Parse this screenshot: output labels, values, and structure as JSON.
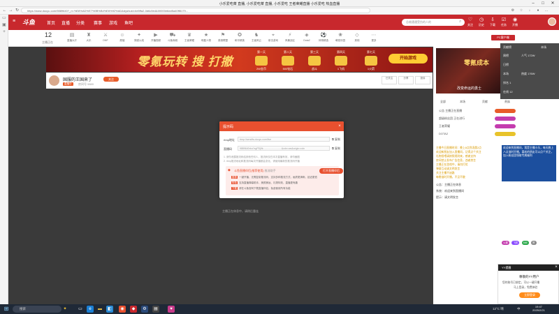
{
  "window": {
    "title": "小乐爱吃菜 直播, 小乐爱吃菜 直播, 小乐爱吃 王者荣耀直播 小乐爱吃 热血直播",
    "url": "https://www.douyu.com/9889640?_ri=%E8%AD%E7%9B%B4%E6%92%AD&dyshuid=be5ffa2-0d6c5b4&00000e6dd5a40ff8179..."
  },
  "site": {
    "logo": "斗鱼",
    "nav": [
      "首页",
      "直播",
      "分类",
      "赛事",
      "游戏",
      "鱼吧"
    ],
    "search_placeholder": "总裁遭遇受伤的人的",
    "header_icons": [
      "关注",
      "历史",
      "下载",
      "任务",
      "开播"
    ]
  },
  "categories": {
    "count": "12",
    "count_label": "主播正在",
    "items": [
      "直播大厅",
      "大乐",
      "DNF",
      "颜值",
      "穿越火线",
      "开播视频",
      "斗鱼商城",
      "王者荣耀",
      "明星人物",
      "英雄联盟",
      "和平精英",
      "王者风云",
      "射击游戏",
      "风暴战区",
      "Dota2",
      "体育精选",
      "萌宠乐园",
      "其他",
      "更多"
    ]
  },
  "banner": {
    "headline": "零氪玩转 搜 打撤",
    "prizes": [
      "第一天",
      "第二天",
      "第三天",
      "第四天",
      "第七天"
    ],
    "prize_values": [
      "2W金币",
      "500钻石",
      "战斗",
      "1飞机",
      "1火箭"
    ],
    "start_label": "开始游戏"
  },
  "streamer": {
    "name": "国服的王国来了",
    "sub": "房间号 9889",
    "tag": "直播中",
    "follow": "关注",
    "buttons": [
      "已关注",
      "分享",
      "投诉"
    ]
  },
  "player": {
    "status": "主播正在休息中，请稍后重连"
  },
  "dialog": {
    "title": "提示码",
    "field1_label": "rtmp地址",
    "field1_value": "rtmp://sendfw.douyu.com/live",
    "field2_label": "直播码",
    "field2_value": "9889640rbu?xgPDj9k...........................&cdn=ws&origin=cdn",
    "copy_label": "复制",
    "note1": "1. 请勿泄露推流码给其他任何人，推流码仅在本次直播有效，请勿截图",
    "note2": "2. rtmp推流地址和推流码每次开播都会变化，请使用最新的推流码开播",
    "promo_title": "斗鱼直播伴侣(推荐使用)",
    "promo_link": "推流助手",
    "promo_button": "打开直播伴侣",
    "promo_lines": [
      {
        "tag": "推荐",
        "text": "一键开播，无需复制推流码，支持多种推流方式，画质更清晰，延迟更低"
      },
      {
        "tag": "特色",
        "text": "支持直播弹幕助手、美颜美妆、礼物特效，直播更有趣"
      },
      {
        "tag": "下载",
        "text": "请在斗鱼官网下载直播伴侣，免费使用所有功能"
      }
    ]
  },
  "right_panel": {
    "pc_client": "PC客户端",
    "ad_text": "改变命运的勇士",
    "ad_title": "零氪成本",
    "rank_header": [
      "贡献榜",
      "本场",
      "全部"
    ],
    "rank_rows": [
      "周榜",
      "日榜",
      "本场",
      "人气 172W",
      "排名 1",
      "热度 176W",
      "在线 12"
    ],
    "tabs": [
      "全部",
      "本场",
      "贡献",
      "贵族"
    ],
    "rows": [
      "公告 主播正在直播",
      "超级粉丝团 正在进行",
      "王者荣耀",
      "DOTA2"
    ],
    "chat_yellow": [
      "主播今日直播时间：晚上8点到凌晨2点",
      "欢迎新朋友加入直播间，记得点个关注",
      "礼物投喂请按照规则来，感谢支持",
      "房间禁止发布广告信息，违者禁言",
      "主播正在游戏中，请勿打扰",
      "弹幕互动请文明发言",
      "关注主播不迷路",
      "每晚准时开播，不见不散"
    ],
    "chat_blue": "欢迎来到直播间，我是主播小乐，每天晚上八点准时开播，喜欢的朋友可以点个关注，加入粉丝团领取专属福利",
    "chat_lines": [
      "公告：主播正在休息",
      "系统：欢迎来到直播间",
      "提示：请文明发言"
    ],
    "gifts": [
      "火箭",
      "飞机",
      "666",
      "赞"
    ]
  },
  "yy_popup": {
    "header": "YY提醒",
    "title": "尊敬的YY用户",
    "line1": "您的账号已绑定，可以一键开播",
    "line2": "马上登录，免费体验",
    "button": "立即登录"
  },
  "taskbar": {
    "search": "搜索",
    "weather": "12°C 晴",
    "ime": "中",
    "time": "19:47",
    "date": "2025/2/21"
  }
}
